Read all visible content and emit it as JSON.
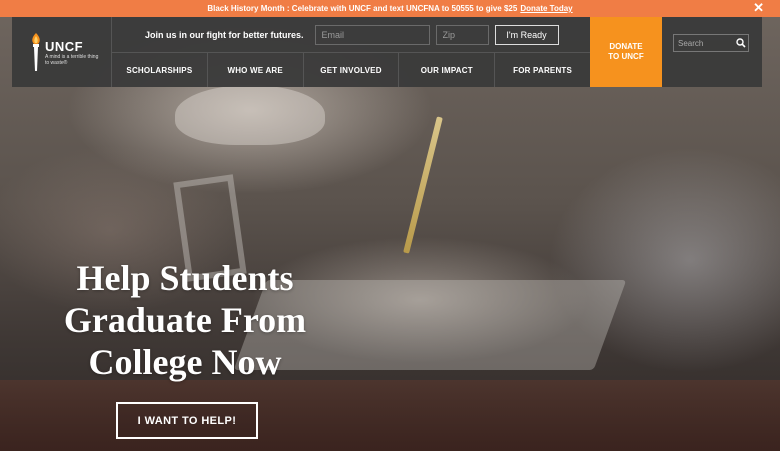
{
  "announcement": {
    "text": "Black History Month : Celebrate with UNCF and text UNCFNA to 50555 to give $25",
    "link": "Donate Today",
    "close": "✕"
  },
  "logo": {
    "name": "UNCF",
    "tagline": "A mind is a terrible thing to waste®"
  },
  "signup": {
    "text": "Join us in our fight for better futures.",
    "email_placeholder": "Email",
    "zip_placeholder": "Zip",
    "button": "I'm Ready"
  },
  "nav": {
    "items": [
      {
        "label": "SCHOLARSHIPS"
      },
      {
        "label": "WHO WE ARE"
      },
      {
        "label": "GET INVOLVED"
      },
      {
        "label": "OUR IMPACT"
      },
      {
        "label": "FOR PARENTS"
      }
    ]
  },
  "donate": {
    "line1": "DONATE",
    "line2": "TO UNCF"
  },
  "search": {
    "placeholder": "Search"
  },
  "hero": {
    "title": "Help Students Graduate From College Now",
    "cta": "I WANT TO HELP!"
  },
  "colors": {
    "announcement_bar": "#f07d45",
    "donate": "#f6921e",
    "header": "#3a3a3a"
  }
}
